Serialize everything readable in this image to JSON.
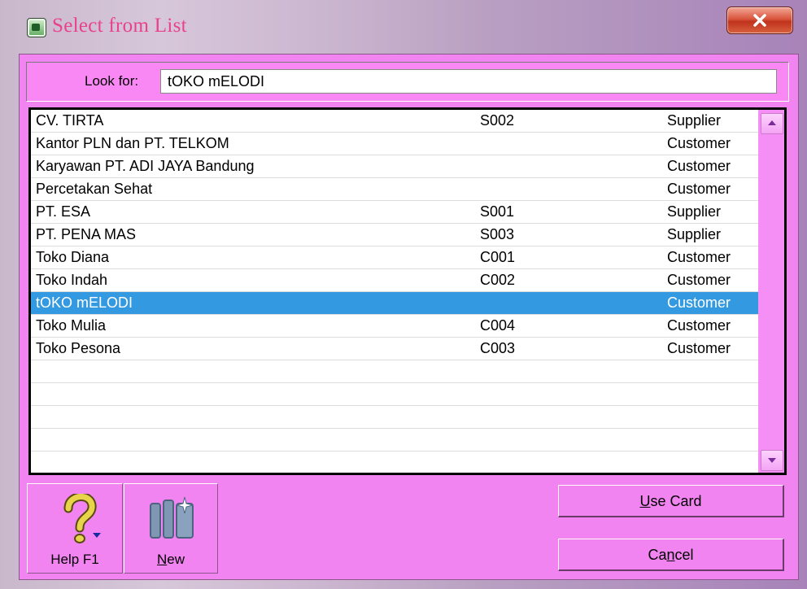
{
  "window": {
    "title": "Select from List",
    "close_icon": "close-icon"
  },
  "lookfor": {
    "label": "Look for:",
    "value": "tOKO mELODI"
  },
  "list": {
    "rows": [
      {
        "name": "CV. TIRTA",
        "code": "S002",
        "type": "Supplier"
      },
      {
        "name": "Kantor PLN dan PT. TELKOM",
        "code": "",
        "type": "Customer"
      },
      {
        "name": "Karyawan PT. ADI JAYA Bandung",
        "code": "",
        "type": "Customer"
      },
      {
        "name": "Percetakan Sehat",
        "code": "",
        "type": "Customer"
      },
      {
        "name": "PT. ESA",
        "code": "S001",
        "type": "Supplier"
      },
      {
        "name": "PT. PENA MAS",
        "code": "S003",
        "type": "Supplier"
      },
      {
        "name": "Toko Diana",
        "code": "C001",
        "type": "Customer"
      },
      {
        "name": "Toko Indah",
        "code": "C002",
        "type": "Customer"
      },
      {
        "name": "tOKO mELODI",
        "code": "",
        "type": "Customer",
        "selected": true
      },
      {
        "name": "Toko Mulia",
        "code": "C004",
        "type": "Customer"
      },
      {
        "name": "Toko Pesona",
        "code": "C003",
        "type": "Customer"
      },
      {
        "name": "",
        "code": "",
        "type": ""
      },
      {
        "name": "",
        "code": "",
        "type": ""
      },
      {
        "name": "",
        "code": "",
        "type": ""
      },
      {
        "name": "",
        "code": "",
        "type": ""
      },
      {
        "name": "",
        "code": "",
        "type": ""
      }
    ]
  },
  "toolbar": {
    "help_label": "Help F1",
    "help_icon": "help-question-icon",
    "new_label_underlined": "N",
    "new_label_rest": "ew",
    "new_icon": "new-card-icon"
  },
  "buttons": {
    "use_card_underlined": "U",
    "use_card_rest": "se Card",
    "cancel_pre": "Ca",
    "cancel_underlined": "n",
    "cancel_post": "cel"
  },
  "colors": {
    "client_bg": "#f184f0",
    "selection": "#3399e0",
    "title_text": "#e8428a"
  }
}
